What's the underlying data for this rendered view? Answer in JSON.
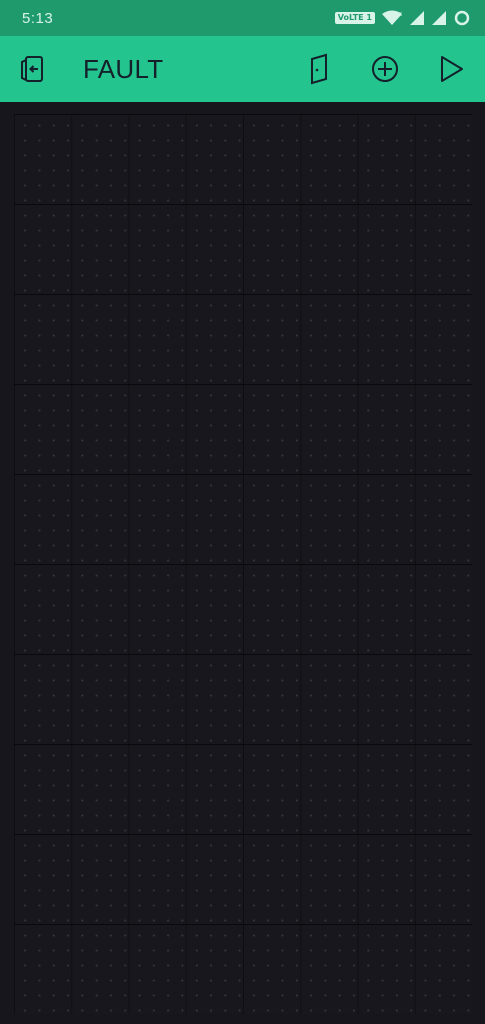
{
  "status_bar": {
    "time": "5:13",
    "volte_label": "VoLTE 1",
    "icons": [
      "wifi-icon",
      "signal-icon",
      "signal-icon",
      "loading-ring-icon"
    ]
  },
  "app_bar": {
    "title": "FAULT",
    "background_color": "#23c48e",
    "icons": [
      "exit-door-icon",
      "door-icon",
      "add-circle-icon",
      "play-icon"
    ]
  },
  "canvas": {
    "background_color": "#16161c"
  }
}
